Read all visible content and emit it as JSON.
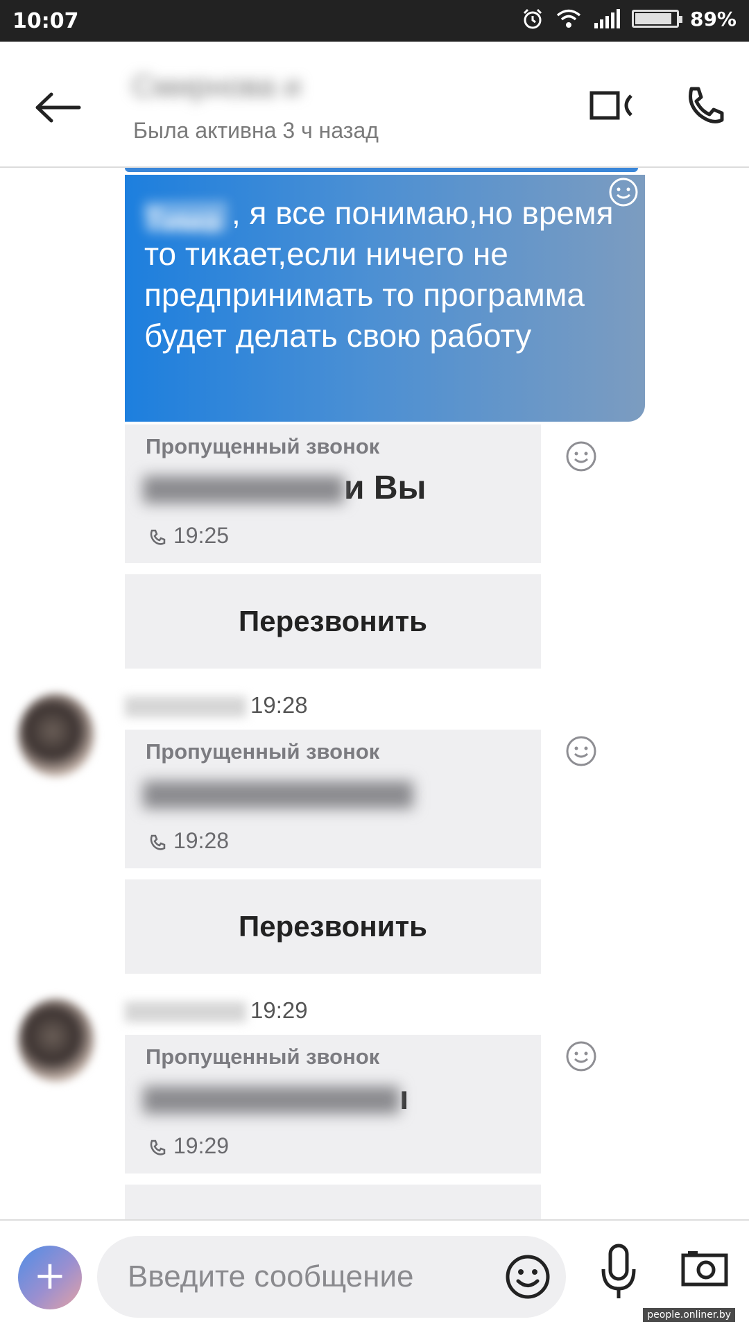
{
  "status_bar": {
    "time": "10:07",
    "battery_pct": "89%",
    "battery_level": 0.89
  },
  "header": {
    "contact_name": "Смирнова и",
    "presence": "Была активна 3 ч назад"
  },
  "messages": {
    "bubble": {
      "name": "Тима",
      "text": ", я все понимаю,но время то тикает,если ничего не предпринимать то программа будет делать свою работу"
    },
    "calls": [
      {
        "title": "Пропущенный звонок",
        "who_suffix": "и Вы",
        "time": "19:25",
        "callback": "Перезвонить"
      },
      {
        "sender_time": "19:28",
        "title": "Пропущенный звонок",
        "who_suffix": "",
        "time": "19:28",
        "callback": "Перезвонить"
      },
      {
        "sender_time": "19:29",
        "title": "Пропущенный звонок",
        "who_suffix": "ı",
        "time": "19:29"
      }
    ]
  },
  "composer": {
    "placeholder": "Введите сообщение",
    "plus_label": "+"
  },
  "watermark": "people.onliner.by",
  "icons": [
    "back-arrow-icon",
    "video-call-icon",
    "phone-call-icon",
    "smiley-icon",
    "microphone-icon",
    "camera-icon",
    "plus-icon",
    "missed-call-icon"
  ]
}
